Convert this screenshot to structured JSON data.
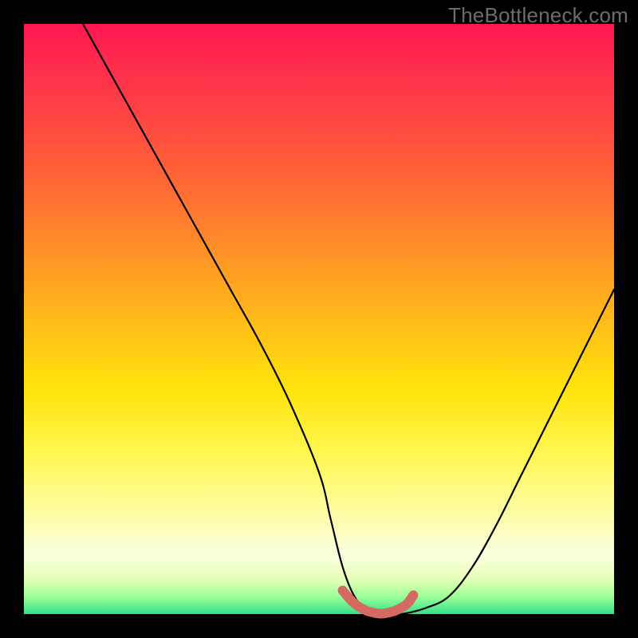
{
  "watermark": "TheBottleneck.com",
  "chart_data": {
    "type": "line",
    "title": "",
    "xlabel": "",
    "ylabel": "",
    "xlim": [
      0,
      100
    ],
    "ylim": [
      0,
      100
    ],
    "series": [
      {
        "name": "curve",
        "x": [
          10,
          15,
          20,
          25,
          30,
          35,
          40,
          45,
          50,
          52,
          54,
          56,
          58,
          60,
          62,
          64,
          68,
          72,
          76,
          80,
          84,
          88,
          92,
          96,
          100
        ],
        "y": [
          100,
          91,
          82,
          73,
          64,
          55,
          46,
          36,
          24,
          16,
          8,
          3,
          1,
          0,
          0,
          0,
          1,
          3,
          8,
          15,
          23,
          31,
          39,
          47,
          55
        ]
      },
      {
        "name": "highlight",
        "x": [
          54,
          55,
          56,
          57,
          58,
          59,
          60,
          61,
          62,
          63,
          64,
          65,
          66
        ],
        "y": [
          4,
          2.8,
          1.8,
          1.1,
          0.6,
          0.3,
          0.1,
          0.1,
          0.3,
          0.6,
          1.1,
          1.8,
          3.2
        ]
      }
    ],
    "colors": {
      "curve": "#000000",
      "highlight": "#d56a62",
      "gradient_top": "#ff1852",
      "gradient_bottom": "#33e28a"
    }
  }
}
